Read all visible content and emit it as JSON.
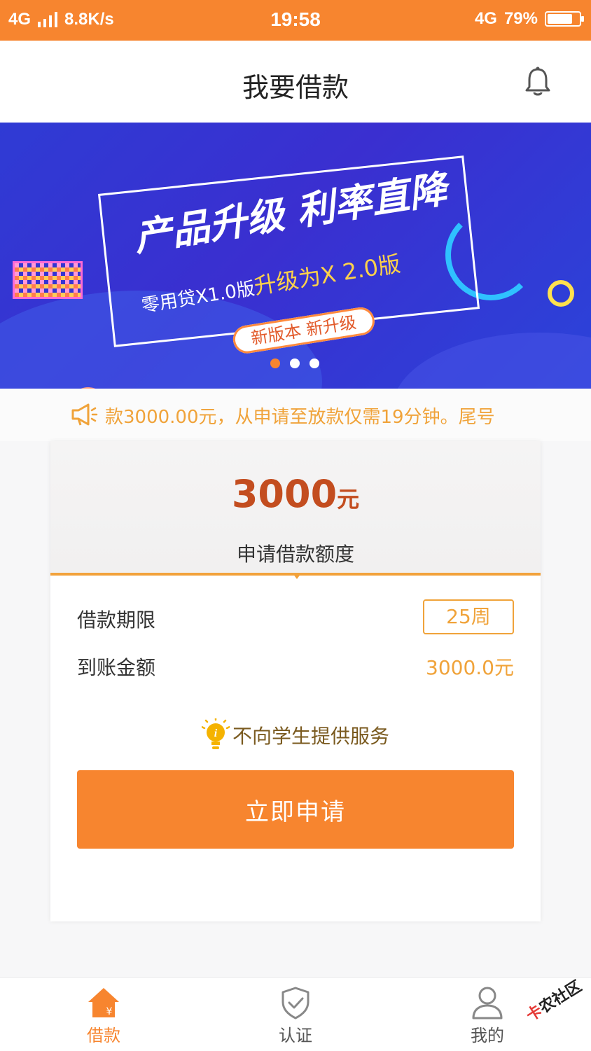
{
  "status_bar": {
    "network_left": "4G",
    "speed": "8.8K/s",
    "time": "19:58",
    "network_right": "4G",
    "battery_percent": "79%",
    "battery_level": 0.79
  },
  "header": {
    "title": "我要借款"
  },
  "banner": {
    "headline": "产品升级  利率直降",
    "subline_prefix": "零用贷X1.0版",
    "subline_highlight": "升级为X 2.0版",
    "pill": "新版本 新升级",
    "page_count": 3,
    "active_index": 0
  },
  "notice": {
    "text": "款3000.00元，从申请至放款仅需19分钟。尾号"
  },
  "loan": {
    "amount": "3000",
    "amount_unit": "元",
    "amount_label": "申请借款额度",
    "term_label": "借款期限",
    "term_value": "25周",
    "received_label": "到账金额",
    "received_value": "3000.0元",
    "tip": "不向学生提供服务",
    "apply_button": "立即申请"
  },
  "tabbar": {
    "items": [
      {
        "label": "借款",
        "active": true
      },
      {
        "label": "认证",
        "active": false
      },
      {
        "label": "我的",
        "active": false
      }
    ]
  },
  "watermark": {
    "text_red": "卡",
    "text": "农社区"
  },
  "colors": {
    "accent": "#f7852f",
    "amount": "#c34d1f",
    "value": "#f0a33a"
  }
}
